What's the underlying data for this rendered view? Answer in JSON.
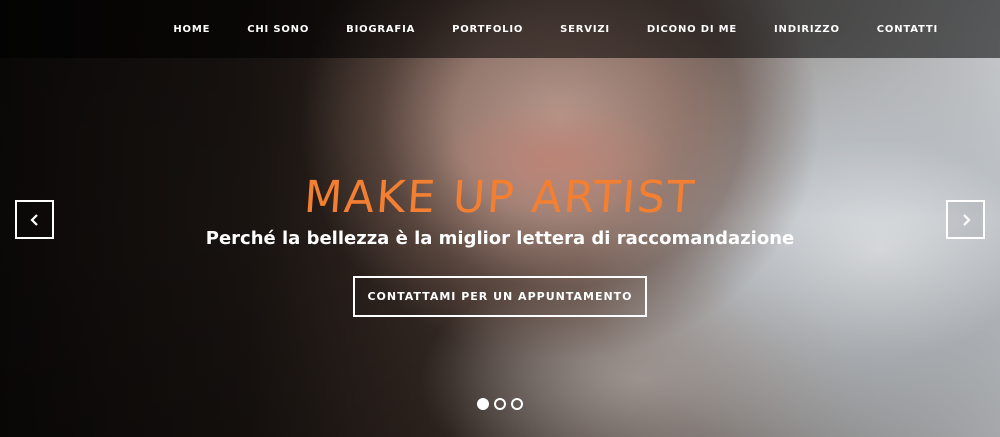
{
  "nav": {
    "items": [
      "HOME",
      "CHI SONO",
      "BIOGRAFIA",
      "PORTFOLIO",
      "SERVIZI",
      "DICONO DI ME",
      "INDIRIZZO",
      "CONTATTI"
    ]
  },
  "hero": {
    "title": "MAKE UP ARTIST",
    "subtitle": "Perché la bellezza è la miglior lettera di raccomandazione",
    "cta_label": "CONTATTAMI PER UN APPUNTAMENTO",
    "title_color": "#f27f32"
  },
  "carousel": {
    "prev_icon": "chevron-left-icon",
    "next_icon": "chevron-right-icon",
    "slide_count": 3,
    "active_index": 0
  }
}
